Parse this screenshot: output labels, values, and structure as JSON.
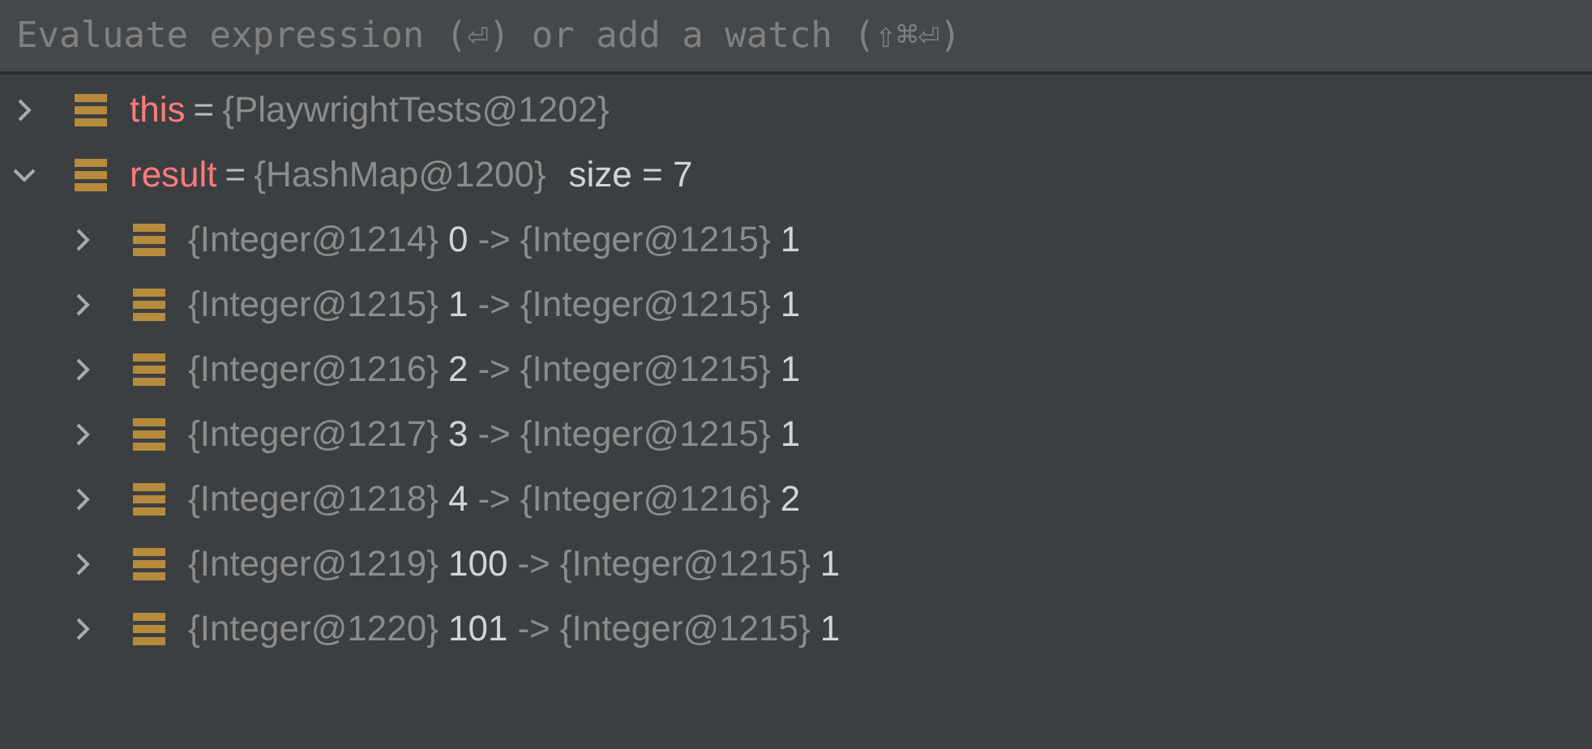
{
  "watch_field": {
    "placeholder": "Evaluate expression (⏎) or add a watch (⇧⌘⏎)"
  },
  "variables": [
    {
      "name": "this",
      "equals": "=",
      "value": "{PlaywrightTests@1202}",
      "expanded": false
    },
    {
      "name": "result",
      "equals": "=",
      "value": "{HashMap@1200}",
      "extra": "size = 7",
      "expanded": true,
      "children": [
        {
          "key_ref": "{Integer@1214}",
          "key": "0",
          "arrow": "->",
          "value_ref": "{Integer@1215}",
          "value": "1",
          "expanded": false
        },
        {
          "key_ref": "{Integer@1215}",
          "key": "1",
          "arrow": "->",
          "value_ref": "{Integer@1215}",
          "value": "1",
          "expanded": false
        },
        {
          "key_ref": "{Integer@1216}",
          "key": "2",
          "arrow": "->",
          "value_ref": "{Integer@1215}",
          "value": "1",
          "expanded": false
        },
        {
          "key_ref": "{Integer@1217}",
          "key": "3",
          "arrow": "->",
          "value_ref": "{Integer@1215}",
          "value": "1",
          "expanded": false
        },
        {
          "key_ref": "{Integer@1218}",
          "key": "4",
          "arrow": "->",
          "value_ref": "{Integer@1216}",
          "value": "2",
          "expanded": false
        },
        {
          "key_ref": "{Integer@1219}",
          "key": "100",
          "arrow": "->",
          "value_ref": "{Integer@1215}",
          "value": "1",
          "expanded": false
        },
        {
          "key_ref": "{Integer@1220}",
          "key": "101",
          "arrow": "->",
          "value_ref": "{Integer@1215}",
          "value": "1",
          "expanded": false
        }
      ]
    }
  ]
}
